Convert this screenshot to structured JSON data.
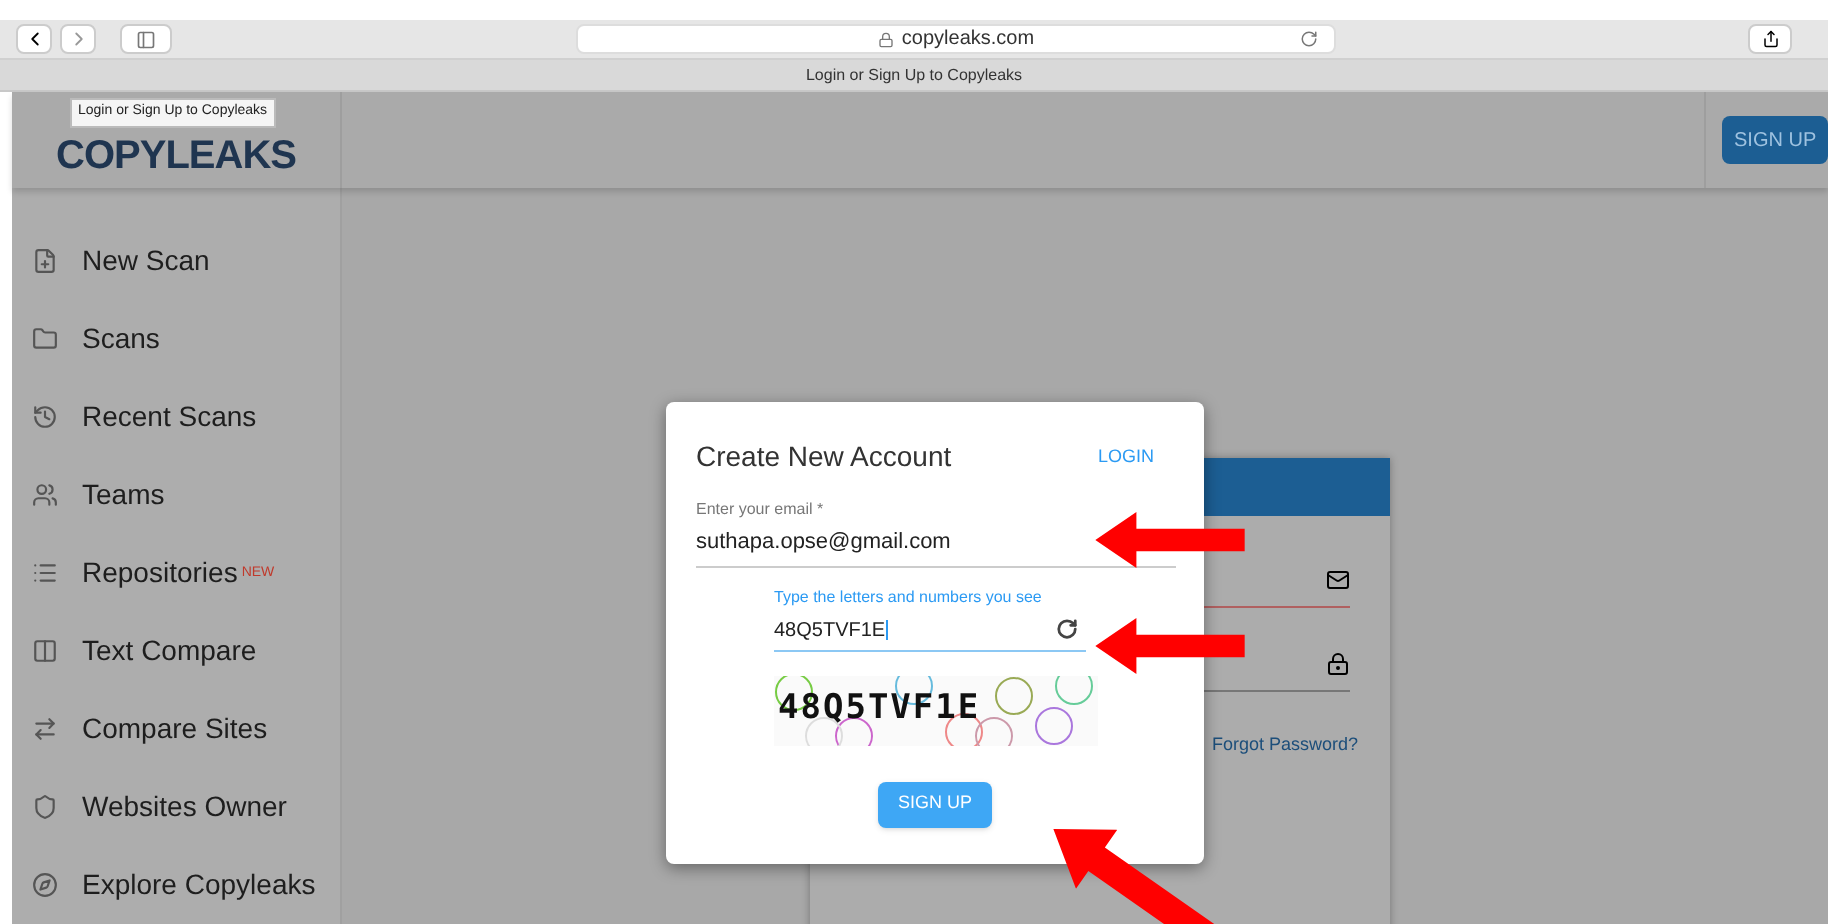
{
  "browser": {
    "url": "copyleaks.com",
    "tab_title": "Login or Sign Up to Copyleaks"
  },
  "header": {
    "logo": "COPYLEAKS",
    "tooltip": "Login or Sign Up to Copyleaks",
    "signup_button": "SIGN UP"
  },
  "sidebar": {
    "items": [
      {
        "label": "New Scan"
      },
      {
        "label": "Scans"
      },
      {
        "label": "Recent Scans"
      },
      {
        "label": "Teams"
      },
      {
        "label": "Repositories",
        "badge": "NEW"
      },
      {
        "label": "Text Compare"
      },
      {
        "label": "Compare Sites"
      },
      {
        "label": "Websites Owner"
      },
      {
        "label": "Explore Copyleaks"
      }
    ]
  },
  "background_card": {
    "forgot_password": "Forgot Password?"
  },
  "dialog": {
    "title": "Create New Account",
    "login_link": "LOGIN",
    "email": {
      "label": "Enter your email *",
      "value": "suthapa.opse@gmail.com"
    },
    "captcha": {
      "label": "Type the letters and numbers you see",
      "value": "48Q5TVF1E",
      "image_text": "48Q5TVF1E"
    },
    "signup_button": "SIGN UP"
  }
}
